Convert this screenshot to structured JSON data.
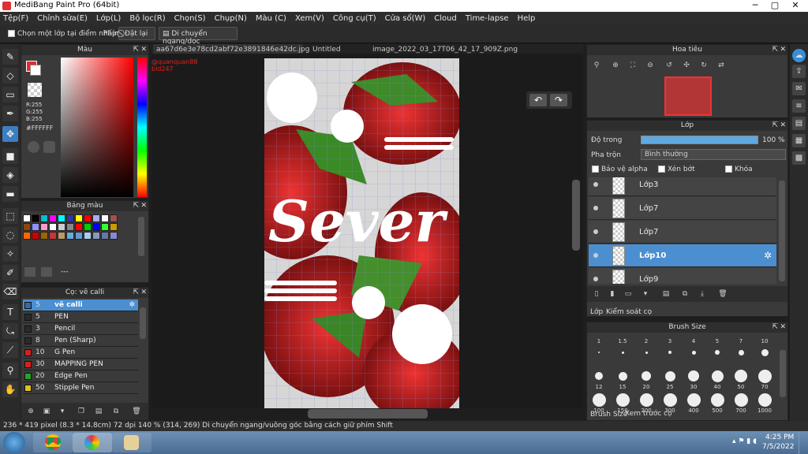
{
  "app": {
    "title": "MediBang Paint Pro (64bit)"
  },
  "menu": [
    "Tệp(F)",
    "Chỉnh sửa(E)",
    "Lớp(L)",
    "Bộ lọc(R)",
    "Chọn(S)",
    "Chụp(N)",
    "Màu (C)",
    "Xem(V)",
    "Công cụ(T)",
    "Cửa sổ(W)",
    "Cloud",
    "Time-lapse",
    "Help"
  ],
  "toolopts": {
    "select_layer_label": "Chọn một lớp tại điểm nhấp",
    "shortcut_label": "Phím",
    "reset_label": "Đặt lại",
    "move_label": "Di chuyển ngang/dọc"
  },
  "color": {
    "title": "Màu",
    "r": "R:255",
    "g": "G:255",
    "b": "B:255",
    "hex": "#FFFFFF",
    "fg": "#ffffff",
    "bg": "#e52b2b"
  },
  "palette": {
    "title": "Bảng màu",
    "note": "---"
  },
  "brush_panel": {
    "title": "Cọ: vẽ calli",
    "items": [
      {
        "size": "5",
        "name": "vẽ calli",
        "color": "#3b6aa0",
        "selected": true
      },
      {
        "size": "5",
        "name": "PEN",
        "color": "#2a2a2a"
      },
      {
        "size": "3",
        "name": "Pencil",
        "color": "#2a2a2a"
      },
      {
        "size": "8",
        "name": "Pen (Sharp)",
        "color": "#2a2a2a"
      },
      {
        "size": "10",
        "name": "G Pen",
        "color": "#d42020"
      },
      {
        "size": "30",
        "name": "MAPPING PEN",
        "color": "#d42020"
      },
      {
        "size": "20",
        "name": "Edge Pen",
        "color": "#28a028"
      },
      {
        "size": "50",
        "name": "Stipple Pen",
        "color": "#e0c020"
      }
    ]
  },
  "tabs": [
    "aa67d6e3e78cd2abf72e3891846e42dc.jpg",
    "Untitled",
    "image_2022_03_17T06_42_17_909Z.png"
  ],
  "canvas": {
    "watermark1": "@quanquan88",
    "watermark2": "bld247",
    "lettering": "Sever"
  },
  "navigator": {
    "title": "Hoa tiêu"
  },
  "layers": {
    "title": "Lớp",
    "opacity_label": "Độ trong",
    "opacity_value": "100 %",
    "blend_label": "Pha trộn",
    "blend_value": "Bình thường",
    "protect_alpha": "Bảo vệ alpha",
    "clip": "Xén bớt",
    "lock": "Khóa",
    "items": [
      {
        "name": "Lớp3"
      },
      {
        "name": "Lớp7"
      },
      {
        "name": "Lớp7"
      },
      {
        "name": "Lớp10",
        "selected": true
      },
      {
        "name": "Lớp9"
      }
    ],
    "tab_layer": "Lớp",
    "tab_brush_control": "Kiểm soát cọ"
  },
  "brush_size": {
    "title": "Brush Size",
    "sizes": [
      "1",
      "1.5",
      "2",
      "3",
      "4",
      "5",
      "7",
      "10",
      "12",
      "15",
      "20",
      "25",
      "30",
      "40",
      "50",
      "70",
      "100",
      "150",
      "200",
      "300",
      "400",
      "500",
      "700",
      "1000"
    ],
    "tab_size": "Brush Size",
    "tab_preview": "Xem trước cọ"
  },
  "status": {
    "text": "236 * 419 pixel  (8.3 * 14.8cm)  72 dpi  140 %  (314, 269)  Di chuyển ngang/vuông góc bằng cách giữ phím Shift"
  },
  "taskbar": {
    "time": "4:25 PM",
    "date": "7/5/2022"
  }
}
